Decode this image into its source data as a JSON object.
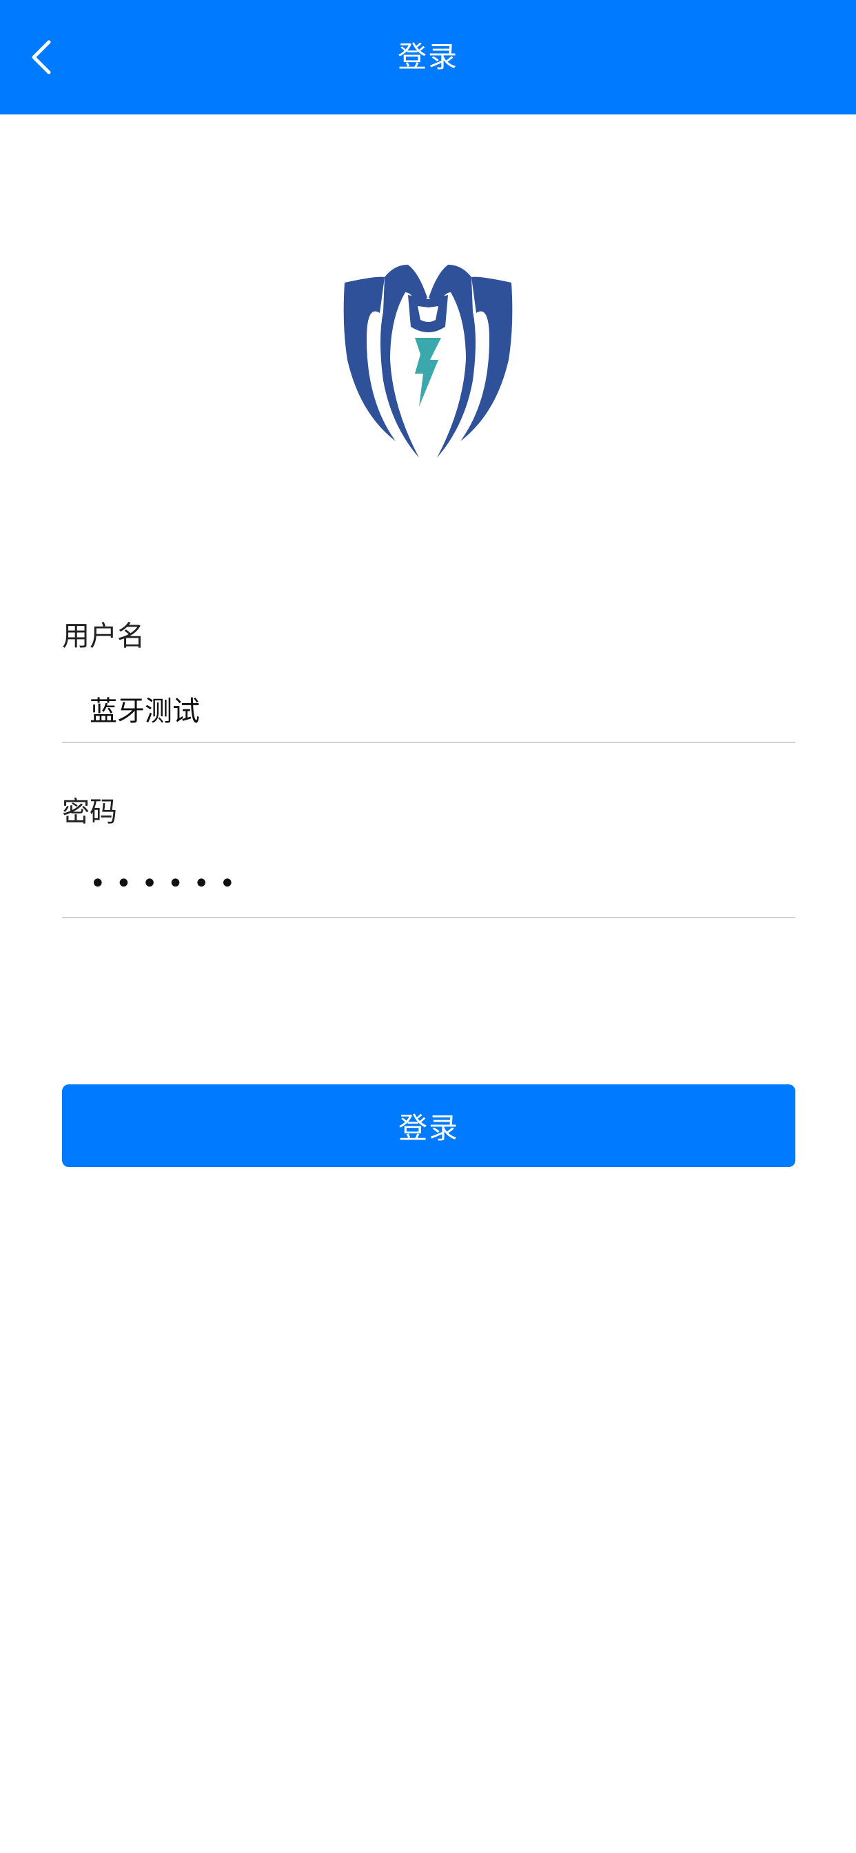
{
  "header": {
    "title": "登录",
    "back_icon": "chevron-left-icon"
  },
  "logo": {
    "icon": "spider-lightning-logo",
    "colors": {
      "body": "#2f5199",
      "bolt": "#3aa8ad"
    }
  },
  "form": {
    "username_label": "用户名",
    "username_value": "蓝牙测试",
    "password_label": "密码",
    "password_value": "••••••"
  },
  "actions": {
    "login_label": "登录"
  },
  "colors": {
    "accent": "#007afe",
    "background": "#ffffff",
    "divider": "#d2d2d2"
  }
}
